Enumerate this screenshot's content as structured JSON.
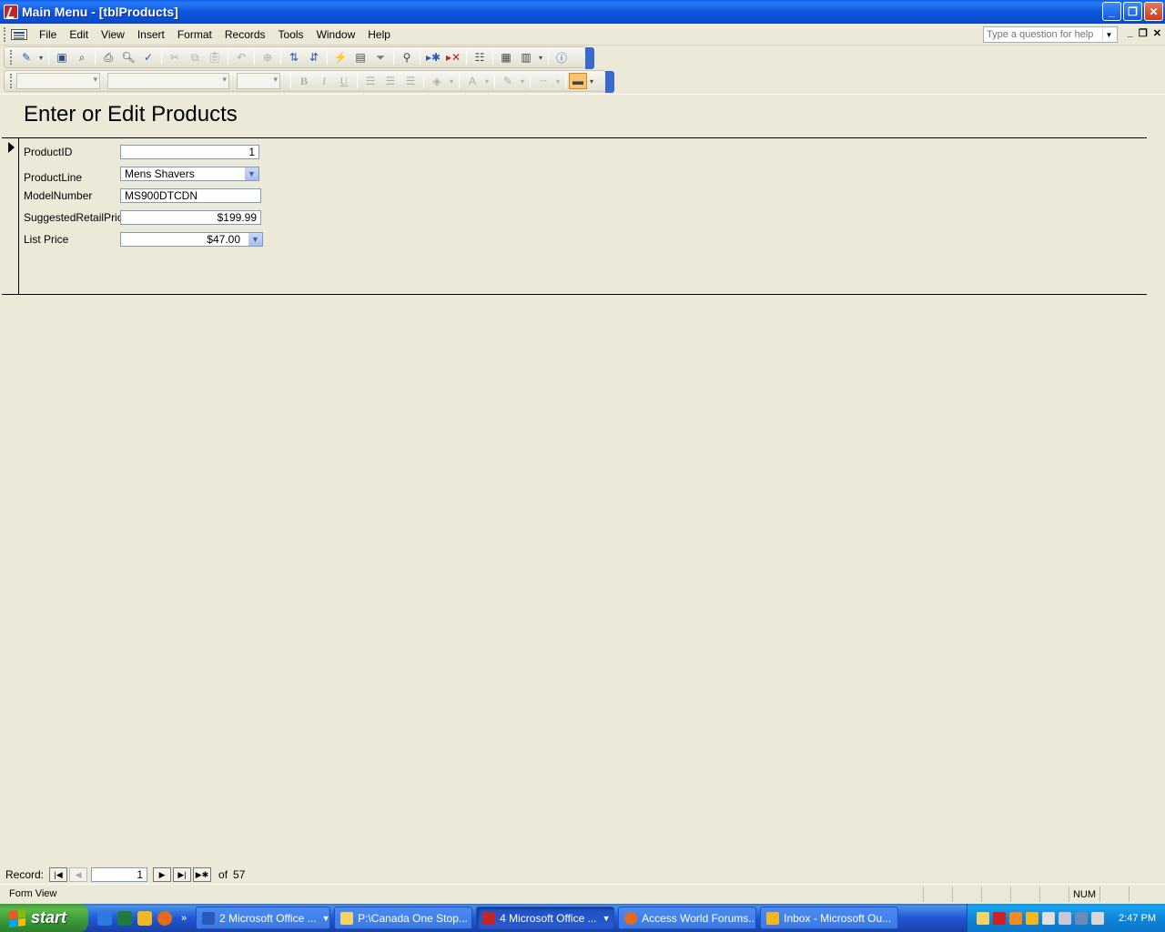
{
  "window": {
    "title": "Main Menu - [tblProducts]"
  },
  "menu": {
    "items": [
      "File",
      "Edit",
      "View",
      "Insert",
      "Format",
      "Records",
      "Tools",
      "Window",
      "Help"
    ],
    "help_placeholder": "Type a question for help"
  },
  "form": {
    "title": "Enter or Edit Products",
    "fields": {
      "product_id": {
        "label": "ProductID",
        "value": "1"
      },
      "product_line": {
        "label": "ProductLine",
        "value": "Mens Shavers"
      },
      "model_number": {
        "label": "ModelNumber",
        "value": "MS900DTCDN"
      },
      "suggested_retail_price": {
        "label": "SuggestedRetailPrice",
        "value": "$199.99"
      },
      "list_price": {
        "label": "List Price",
        "value": "$47.00"
      }
    }
  },
  "record_nav": {
    "label": "Record:",
    "current": "1",
    "of_label": "of",
    "total": "57"
  },
  "status": {
    "text": "Form View",
    "num": "NUM"
  },
  "taskbar": {
    "start_label": "start",
    "tasks": [
      "2 Microsoft Office ...",
      "P:\\Canada One Stop...",
      "4 Microsoft Office ...",
      "Access World Forums...",
      "Inbox - Microsoft Ou..."
    ],
    "clock": "2:47 PM"
  },
  "colors": {
    "title_bar": "#0a5ee8",
    "background": "#ece9d8",
    "field_border": "#7f9db9",
    "start_button": "#3c9b3c"
  }
}
